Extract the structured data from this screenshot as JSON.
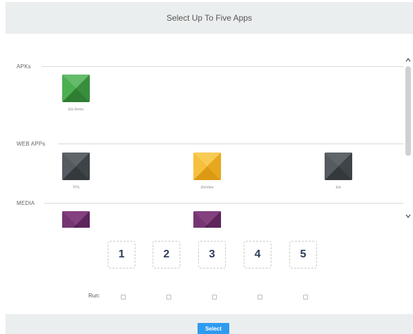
{
  "header": {
    "title": "Select Up To Five Apps"
  },
  "sections": [
    {
      "label": "APKs",
      "apps": [
        {
          "name": "Elo Demo",
          "icon": "app-envelope-green-icon",
          "color": "#43a047"
        }
      ]
    },
    {
      "label": "WEB APPs",
      "apps": [
        {
          "name": "TPS",
          "icon": "app-envelope-grey-icon",
          "color": "#4a5054"
        },
        {
          "name": "EloView",
          "icon": "app-envelope-yellow-icon",
          "color": "#f4b62a"
        },
        {
          "name": "Elo",
          "icon": "app-envelope-grey-icon",
          "color": "#4a5054"
        }
      ]
    },
    {
      "label": "MEDIA",
      "apps": [
        {
          "name": "",
          "icon": "app-envelope-purple-icon",
          "color": "#6a2c68"
        },
        {
          "name": "",
          "icon": "app-envelope-purple-icon",
          "color": "#6a2c68"
        }
      ]
    }
  ],
  "slots": [
    "1",
    "2",
    "3",
    "4",
    "5"
  ],
  "run": {
    "label": "Run:",
    "checked": [
      false,
      false,
      false,
      false,
      false
    ]
  },
  "footer": {
    "select_label": "Select"
  },
  "colors": {
    "accent": "#2f9bf0",
    "slot_text": "#2b3e5a",
    "bar_bg": "#ebeeee"
  }
}
